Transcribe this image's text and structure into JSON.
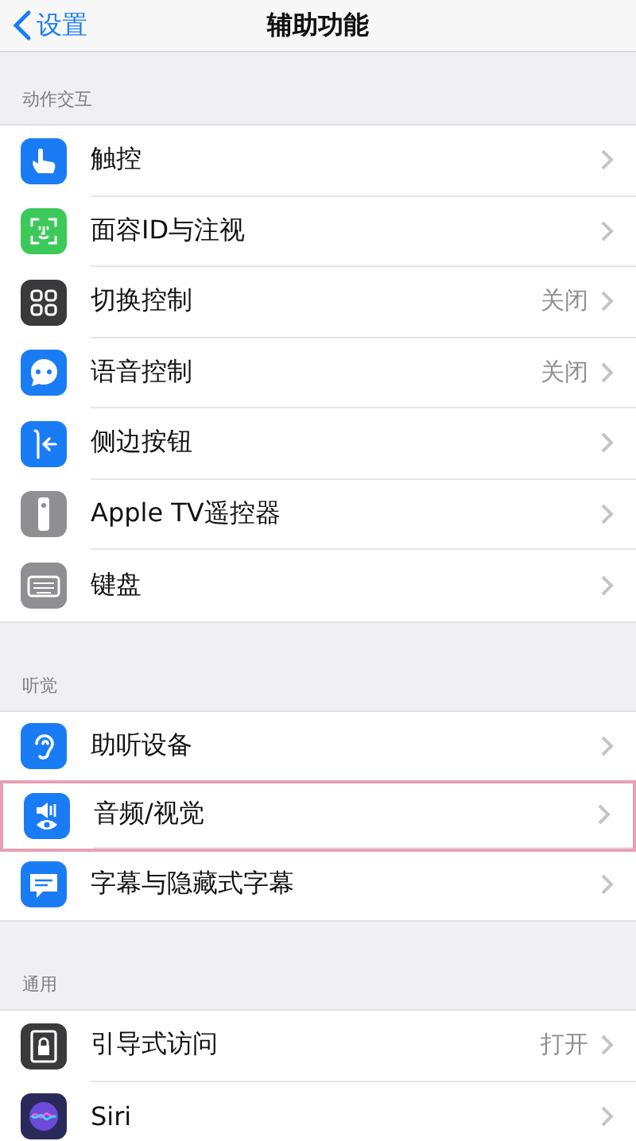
{
  "nav": {
    "back": "设置",
    "title": "辅助功能"
  },
  "sections": [
    {
      "header": "动作交互",
      "items": [
        {
          "label": "触控",
          "kind": "touch",
          "color": "#1a7cf5",
          "highlighted": false
        },
        {
          "label": "面容ID与注视",
          "kind": "face",
          "color": "#3cc95a",
          "highlighted": false
        },
        {
          "label": "切换控制",
          "value": "关闭",
          "kind": "grid",
          "color": "#3a3a3c",
          "highlighted": false
        },
        {
          "label": "语音控制",
          "value": "关闭",
          "kind": "voice",
          "color": "#1a7cf5",
          "highlighted": false
        },
        {
          "label": "侧边按钮",
          "kind": "side",
          "color": "#1a7cf5",
          "highlighted": false
        },
        {
          "label": "Apple TV遥控器",
          "kind": "remote",
          "color": "#8e8e93",
          "highlighted": false
        },
        {
          "label": "键盘",
          "kind": "keyboard",
          "color": "#8e8e93",
          "highlighted": false
        }
      ]
    },
    {
      "header": "听觉",
      "items": [
        {
          "label": "助听设备",
          "kind": "ear",
          "color": "#1a7cf5",
          "highlighted": false
        },
        {
          "label": "音频/视觉",
          "kind": "audio",
          "color": "#1a7cf5",
          "highlighted": true
        },
        {
          "label": "字幕与隐藏式字幕",
          "kind": "captions",
          "color": "#1a7cf5",
          "highlighted": false
        }
      ]
    },
    {
      "header": "通用",
      "items": [
        {
          "label": "引导式访问",
          "value": "打开",
          "kind": "lock",
          "color": "#3a3a3c",
          "highlighted": false
        },
        {
          "label": "Siri",
          "kind": "siri",
          "color": "#2a2a5a",
          "highlighted": false
        }
      ]
    }
  ]
}
